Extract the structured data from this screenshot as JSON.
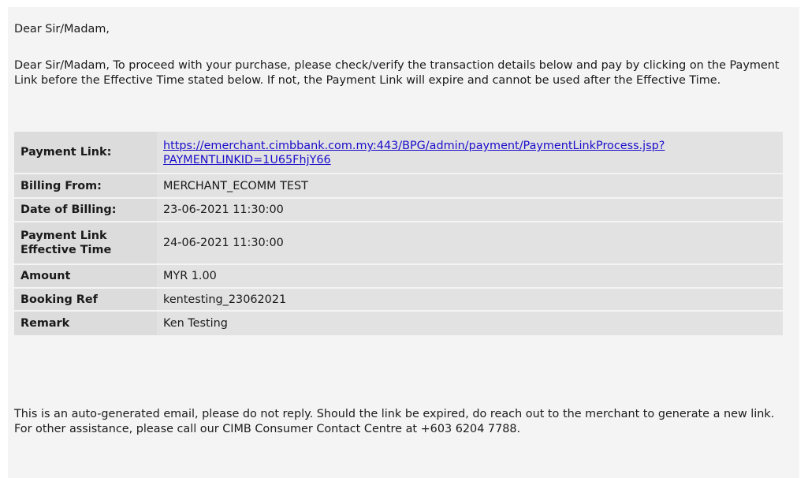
{
  "email": {
    "greeting": "Dear Sir/Madam,",
    "intro": "Dear Sir/Madam, To proceed with your purchase, please check/verify the transaction details below and pay by clicking on the Payment Link before the Effective Time stated below. If not, the Payment Link will expire and cannot be used after the Effective Time.",
    "details": {
      "payment_link_label": "Payment Link:",
      "payment_link_url_line1": "https://emerchant.cimbbank.com.my:443/BPG/admin/payment/PaymentLinkProcess.jsp?",
      "payment_link_url_line2": "PAYMENTLINKID=1U65FhjY66",
      "billing_from_label": "Billing From:",
      "billing_from_value": "MERCHANT_ECOMM TEST",
      "date_of_billing_label": "Date of Billing:",
      "date_of_billing_value": "23-06-2021 11:30:00",
      "effective_time_label_line1": "Payment Link",
      "effective_time_label_line2": "Effective Time",
      "effective_time_value": "24-06-2021 11:30:00",
      "amount_label": "Amount",
      "amount_value": "MYR 1.00",
      "booking_ref_label": "Booking Ref",
      "booking_ref_value": "kentesting_23062021",
      "remark_label": "Remark",
      "remark_value": "Ken Testing"
    },
    "footer": "This is an auto-generated email, please do not reply. Should the link be expired, do reach out to the merchant to generate a new link. For other assistance, please call our CIMB Consumer Contact Centre at +603 6204 7788."
  }
}
